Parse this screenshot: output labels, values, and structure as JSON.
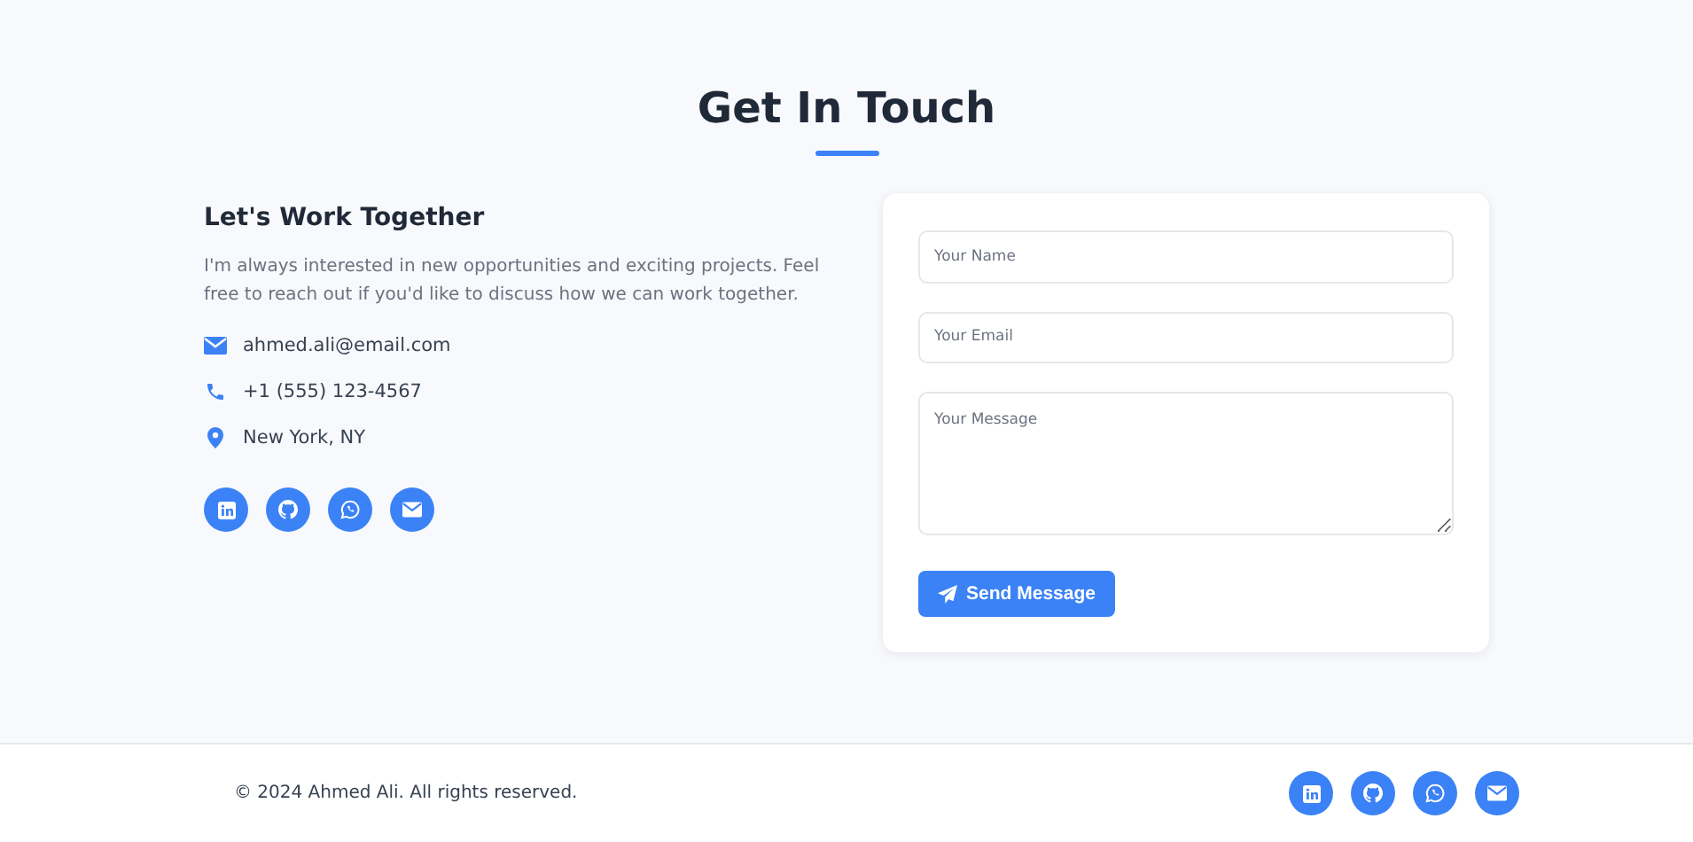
{
  "title": "Get In Touch",
  "intro": {
    "heading": "Let's Work Together",
    "text": "I'm always interested in new opportunities and exciting projects. Feel free to reach out if you'd like to discuss how we can work together."
  },
  "contacts": [
    {
      "kind": "email",
      "text": "ahmed.ali@email.com"
    },
    {
      "kind": "phone",
      "text": "+1 (555) 123-4567"
    },
    {
      "kind": "location",
      "text": "New York, NY"
    }
  ],
  "socials": [
    {
      "kind": "linkedin"
    },
    {
      "kind": "github"
    },
    {
      "kind": "whatsapp"
    },
    {
      "kind": "email"
    }
  ],
  "form": {
    "fields": [
      {
        "kind": "input",
        "placeholder": "Your Name"
      },
      {
        "kind": "input",
        "placeholder": "Your Email"
      },
      {
        "kind": "textarea",
        "placeholder": "Your Message"
      }
    ],
    "button": "Send Message"
  },
  "footer": {
    "copyright": "© 2024 Ahmed Ali. All rights reserved.",
    "socials": [
      {
        "kind": "linkedin"
      },
      {
        "kind": "github"
      },
      {
        "kind": "whatsapp"
      },
      {
        "kind": "email"
      }
    ]
  }
}
